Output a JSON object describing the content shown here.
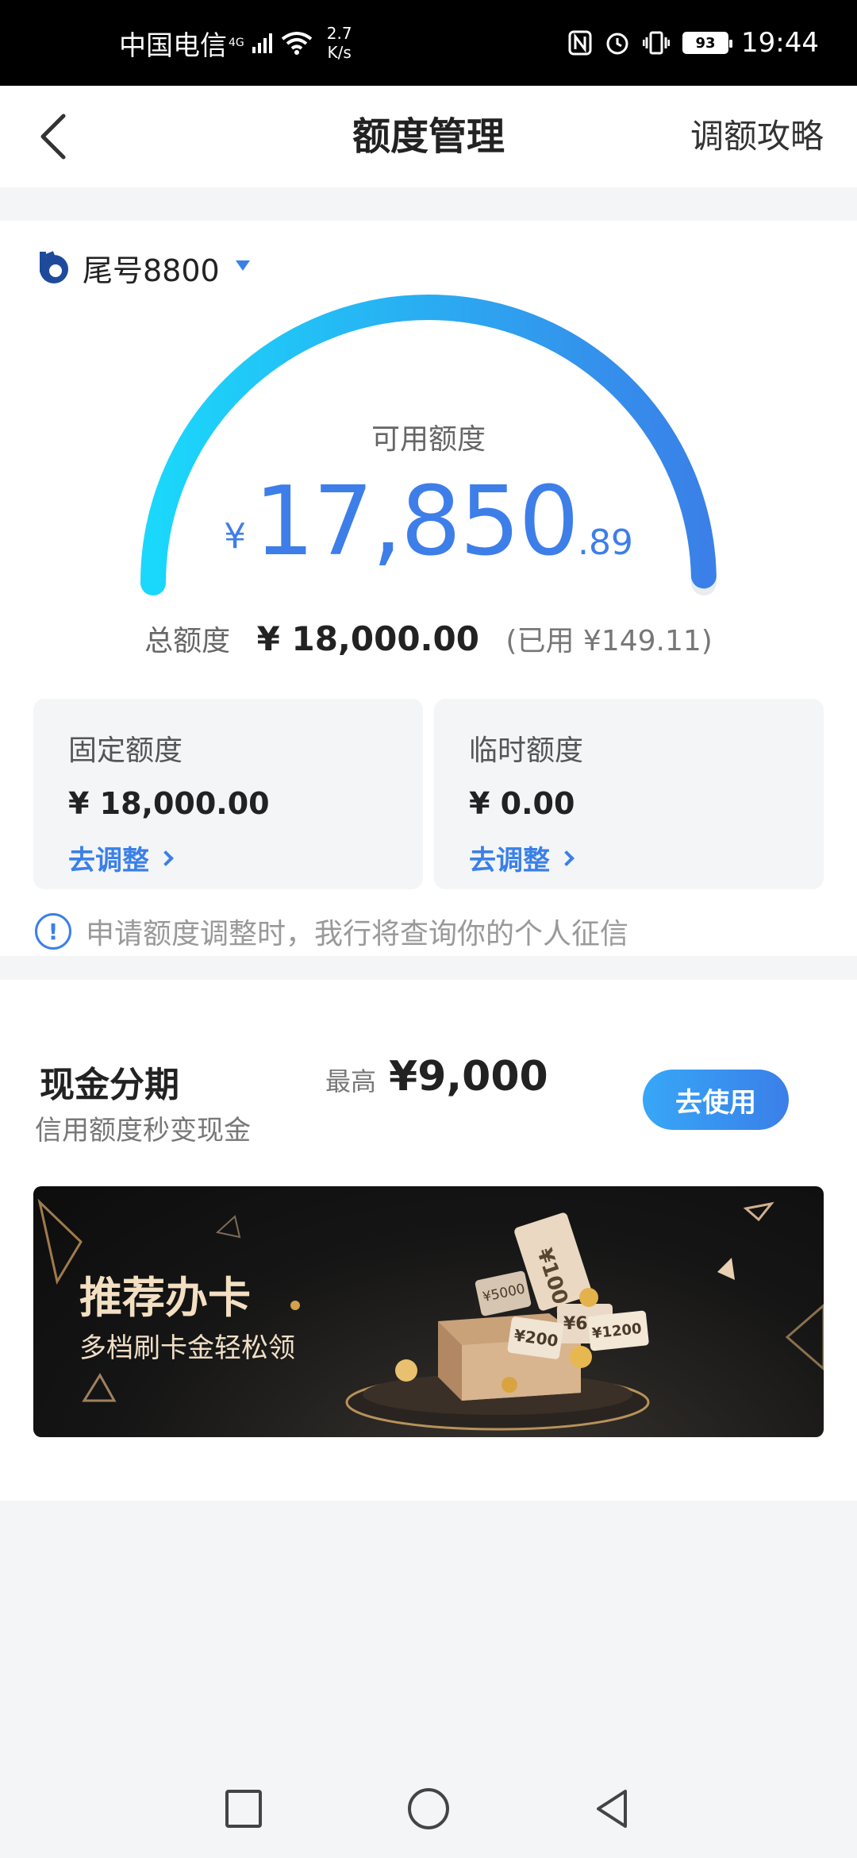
{
  "status_bar": {
    "carrier": "中国电信",
    "network_type": "4G",
    "net_speed_value": "2.7",
    "net_speed_unit": "K/s",
    "battery": "93",
    "time": "19:44"
  },
  "nav": {
    "title": "额度管理",
    "right_link": "调额攻略"
  },
  "card_selector": {
    "label": "尾号8800"
  },
  "gauge": {
    "label": "可用额度",
    "currency": "¥",
    "amount_int": "17,850",
    "amount_dec": ".89",
    "used_fraction": 0.0083,
    "colors": {
      "start": "#1ad8fb",
      "end": "#3a80e8",
      "track": "#e9edf2"
    }
  },
  "total": {
    "label": "总额度",
    "value": "¥ 18,000.00",
    "used": "(已用 ¥149.11)"
  },
  "tiles": [
    {
      "label": "固定额度",
      "value": "¥ 18,000.00",
      "link": "去调整"
    },
    {
      "label": "临时额度",
      "value": "¥ 0.00",
      "link": "去调整"
    }
  ],
  "notice": {
    "icon": "!",
    "text": "申请额度调整时，我行将查询你的个人征信"
  },
  "cash_installment": {
    "title": "现金分期",
    "subtitle": "信用额度秒变现金",
    "max_label": "最高",
    "max_value": "¥9,000",
    "button": "去使用"
  },
  "banner": {
    "title": "推荐办卡",
    "subtitle": "多档刷卡金轻松领",
    "tickets": [
      "¥10000",
      "¥5000",
      "¥600",
      "¥200",
      "¥1200"
    ],
    "ticket_caption": "刷卡金"
  },
  "colors": {
    "accent": "#3a80e8",
    "page_bg": "#f4f5f7"
  }
}
